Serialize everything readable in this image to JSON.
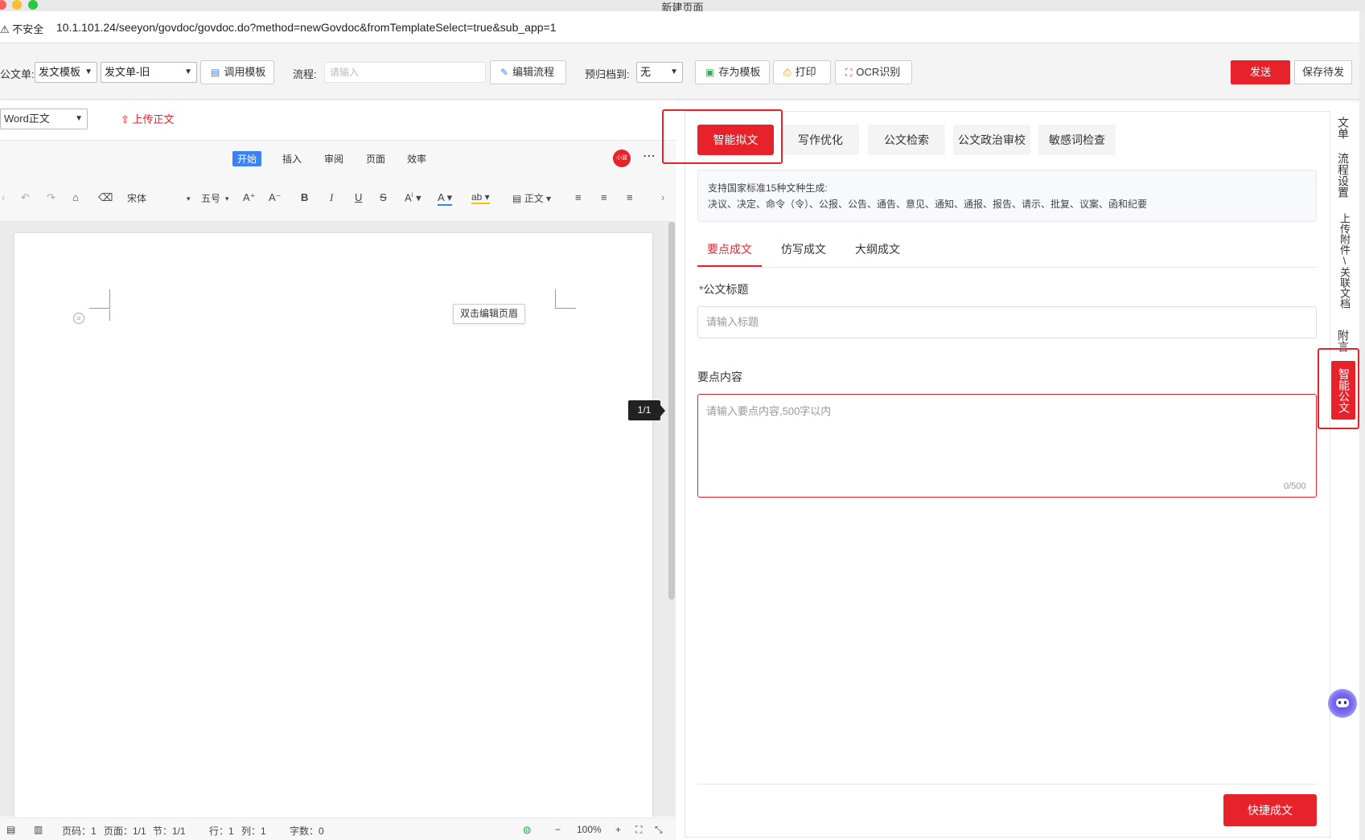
{
  "window": {
    "title": "新建页面"
  },
  "address_bar": {
    "warning": "不安全",
    "url": "10.1.101.24/seeyon/govdoc/govdoc.do?method=newGovdoc&fromTemplateSelect=true&sub_app=1"
  },
  "form_toolbar": {
    "doc_label": "公文单:",
    "doc_type_select": "发文模板",
    "doc_form_select": "发文单-旧",
    "call_template": "调用模板",
    "flow_label": "流程:",
    "flow_placeholder": "请输入",
    "edit_flow": "编辑流程",
    "archive_label": "预归档到:",
    "archive_select": "无",
    "save_template": "存为模板",
    "print": "打印",
    "ocr": "OCR识别",
    "send": "发送",
    "save_pending": "保存待发"
  },
  "editor": {
    "body_select": "Word正文",
    "upload_body": "上传正文",
    "tabs": [
      "开始",
      "插入",
      "审阅",
      "页面",
      "效率"
    ],
    "avatar_text": "小波",
    "font_name": "宋体",
    "font_size": "五号",
    "paragraph_style": "正文",
    "header_tip": "双击编辑页眉",
    "page_indicator": "1/1",
    "status": {
      "page_no": "页码：1",
      "pages": "页面：1/1",
      "section": "节：1/1",
      "row": "行：1",
      "col": "列：1",
      "words": "字数：0",
      "zoom": "100%"
    }
  },
  "panel": {
    "tabs": [
      "智能拟文",
      "写作优化",
      "公文检索",
      "公文政治审校",
      "敏感词检查"
    ],
    "info_line1": "支持国家标准15种文种生成:",
    "info_line2": "决议、决定、命令（令）、公报、公告、通告、意见、通知、通报、报告、请示、批复、议案、函和纪要",
    "sub_tabs": [
      "要点成文",
      "仿写成文",
      "大纲成文"
    ],
    "title_label": "公文标题",
    "title_placeholder": "请输入标题",
    "points_label": "要点内容",
    "points_placeholder": "请输入要点内容,500字以内",
    "counter": "0/500",
    "quick_button": "快捷成文"
  },
  "side_tabs": [
    "文单",
    "流程设置",
    "上传附件\\关联文档",
    "附言",
    "智能公文"
  ],
  "colors": {
    "accent": "#e8222b",
    "editor_tab_active": "#3b82f6"
  }
}
